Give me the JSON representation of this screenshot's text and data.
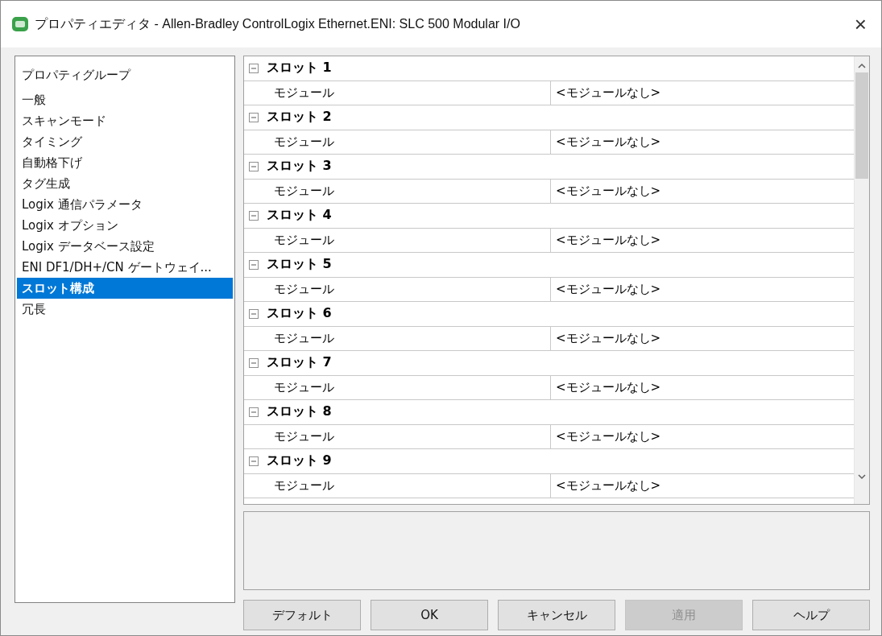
{
  "window": {
    "title": "プロパティエディタ - Allen-Bradley ControlLogix Ethernet.ENI: SLC 500 Modular I/O",
    "close": "×"
  },
  "property_groups": {
    "header": "プロパティグループ",
    "items": [
      {
        "label": "一般",
        "selected": false
      },
      {
        "label": "スキャンモード",
        "selected": false
      },
      {
        "label": "タイミング",
        "selected": false
      },
      {
        "label": "自動格下げ",
        "selected": false
      },
      {
        "label": "タグ生成",
        "selected": false
      },
      {
        "label": "Logix 通信パラメータ",
        "selected": false
      },
      {
        "label": "Logix オプション",
        "selected": false
      },
      {
        "label": "Logix データベース設定",
        "selected": false
      },
      {
        "label": "ENI DF1/DH+/CN ゲートウェイ...",
        "selected": false
      },
      {
        "label": "スロット構成",
        "selected": true
      },
      {
        "label": "冗長",
        "selected": false
      }
    ]
  },
  "slots": [
    {
      "name": "スロット 1",
      "expanded": true,
      "properties": [
        {
          "name": "モジュール",
          "value": "<モジュールなし>"
        }
      ]
    },
    {
      "name": "スロット 2",
      "expanded": true,
      "properties": [
        {
          "name": "モジュール",
          "value": "<モジュールなし>"
        }
      ]
    },
    {
      "name": "スロット 3",
      "expanded": true,
      "properties": [
        {
          "name": "モジュール",
          "value": "<モジュールなし>"
        }
      ]
    },
    {
      "name": "スロット 4",
      "expanded": true,
      "properties": [
        {
          "name": "モジュール",
          "value": "<モジュールなし>"
        }
      ]
    },
    {
      "name": "スロット 5",
      "expanded": true,
      "properties": [
        {
          "name": "モジュール",
          "value": "<モジュールなし>"
        }
      ]
    },
    {
      "name": "スロット 6",
      "expanded": true,
      "properties": [
        {
          "name": "モジュール",
          "value": "<モジュールなし>"
        }
      ]
    },
    {
      "name": "スロット 7",
      "expanded": true,
      "properties": [
        {
          "name": "モジュール",
          "value": "<モジュールなし>"
        }
      ]
    },
    {
      "name": "スロット 8",
      "expanded": true,
      "properties": [
        {
          "name": "モジュール",
          "value": "<モジュールなし>"
        }
      ]
    },
    {
      "name": "スロット 9",
      "expanded": true,
      "properties": [
        {
          "name": "モジュール",
          "value": "<モジュールなし>"
        }
      ]
    }
  ],
  "buttons": [
    {
      "label": "デフォルト",
      "disabled": false
    },
    {
      "label": "OK",
      "disabled": false
    },
    {
      "label": "キャンセル",
      "disabled": false
    },
    {
      "label": "適用",
      "disabled": true
    },
    {
      "label": "ヘルプ",
      "disabled": false
    }
  ]
}
